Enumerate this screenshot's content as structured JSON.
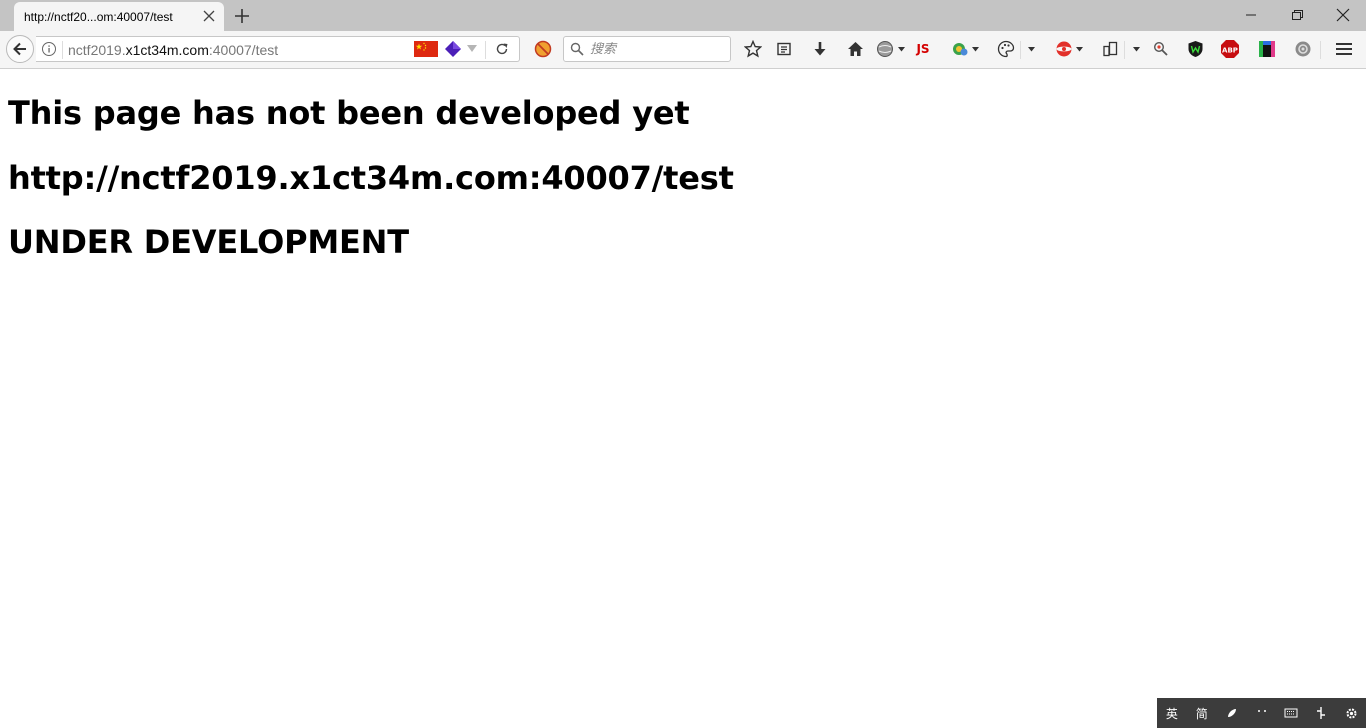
{
  "tab": {
    "title": "http://nctf20...om:40007/test"
  },
  "urlbar": {
    "prefix": "nctf2019.",
    "domain": "x1ct34m.com",
    "suffix": ":40007/test"
  },
  "search": {
    "placeholder": "搜索"
  },
  "toolbar": {
    "js_label": "JS",
    "abp_label": "ABP"
  },
  "page": {
    "heading1": "This page has not been developed yet",
    "heading2": "http://nctf2019.x1ct34m.com:40007/test",
    "heading3": "UNDER DEVELOPMENT"
  },
  "ime": {
    "lang": "英",
    "mode": "简"
  },
  "colors": {
    "tabstrip": "#c4c4c4",
    "toolbar": "#f5f5f5",
    "js_red": "#d40000",
    "ime_bg": "#3c3c3c"
  }
}
